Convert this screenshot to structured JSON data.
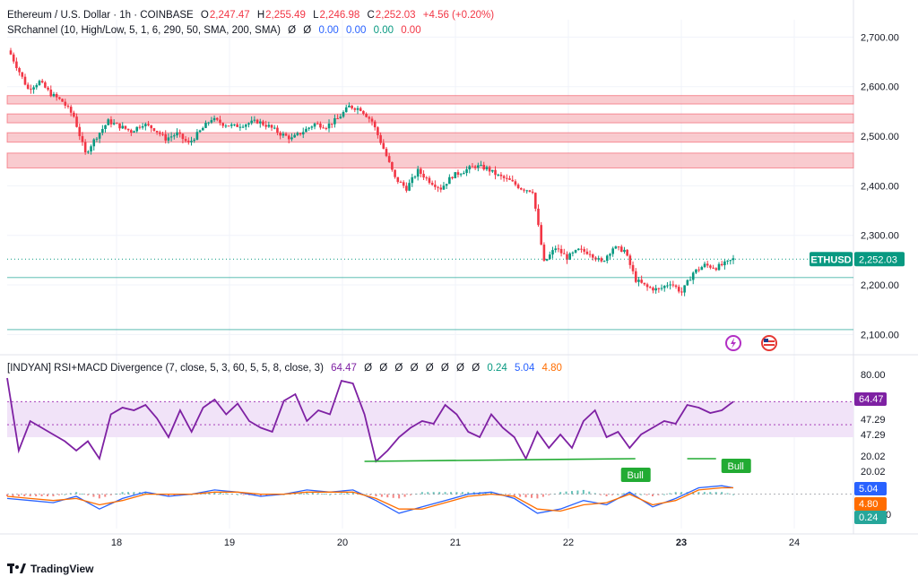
{
  "header": {
    "symbol": "Ethereum / U.S. Dollar · 1h · COINBASE",
    "o_label": "O",
    "o_value": "2,247.47",
    "h_label": "H",
    "h_value": "2,255.49",
    "l_label": "L",
    "l_value": "2,246.98",
    "c_label": "C",
    "c_value": "2,252.03",
    "change": "+4.56 (+0.20%)",
    "indicator1": "SRchannel (10, High/Low, 5, 1, 6, 290, 50, SMA, 200, SMA)",
    "indicator1_values": [
      "Ø",
      "Ø",
      "0.00",
      "0.00",
      "0.00",
      "0.00"
    ],
    "indicator2": "[INDYAN] RSI+MACD Divergence (7, close, 5, 3, 60, 5, 5, 8, close, 3)",
    "indicator2_values": [
      "64.47",
      "Ø",
      "Ø",
      "Ø",
      "Ø",
      "Ø",
      "Ø",
      "Ø",
      "Ø",
      "0.24",
      "5.04",
      "4.80"
    ]
  },
  "footer": {
    "brand": "TradingView"
  },
  "chart_data": [
    {
      "type": "candlestick",
      "ticker_label": "ETHUSD",
      "last_price": "2,252.03",
      "y_ticks": [
        "2,700.00",
        "2,600.00",
        "2,500.00",
        "2,400.00",
        "2,300.00",
        "2,200.00",
        "2,100.00"
      ],
      "ylim": [
        2070,
        2735
      ],
      "x_ticks": [
        "18",
        "19",
        "20",
        "21",
        "22",
        "23",
        "24"
      ],
      "resistance_zones": [
        [
          2565,
          2582
        ],
        [
          2527,
          2545
        ],
        [
          2488,
          2507
        ],
        [
          2436,
          2466
        ]
      ],
      "support_lines": [
        2215,
        2110
      ],
      "close_path": [
        [
          0,
          2665
        ],
        [
          6,
          2595
        ],
        [
          10,
          2610
        ],
        [
          14,
          2585
        ],
        [
          18,
          2570
        ],
        [
          22,
          2540
        ],
        [
          26,
          2465
        ],
        [
          30,
          2500
        ],
        [
          34,
          2530
        ],
        [
          38,
          2520
        ],
        [
          42,
          2510
        ],
        [
          46,
          2525
        ],
        [
          50,
          2515
        ],
        [
          54,
          2495
        ],
        [
          58,
          2505
        ],
        [
          62,
          2485
        ],
        [
          66,
          2510
        ],
        [
          70,
          2535
        ],
        [
          74,
          2525
        ],
        [
          78,
          2520
        ],
        [
          82,
          2525
        ],
        [
          86,
          2530
        ],
        [
          90,
          2520
        ],
        [
          94,
          2505
        ],
        [
          98,
          2495
        ],
        [
          102,
          2510
        ],
        [
          106,
          2525
        ],
        [
          110,
          2520
        ],
        [
          114,
          2535
        ],
        [
          118,
          2560
        ],
        [
          122,
          2555
        ],
        [
          126,
          2530
        ],
        [
          130,
          2475
        ],
        [
          134,
          2415
        ],
        [
          138,
          2395
        ],
        [
          142,
          2430
        ],
        [
          146,
          2410
        ],
        [
          150,
          2395
        ],
        [
          154,
          2420
        ],
        [
          158,
          2430
        ],
        [
          162,
          2440
        ],
        [
          166,
          2435
        ],
        [
          170,
          2420
        ],
        [
          174,
          2410
        ],
        [
          178,
          2395
        ],
        [
          182,
          2390
        ],
        [
          186,
          2245
        ],
        [
          190,
          2275
        ],
        [
          194,
          2255
        ],
        [
          198,
          2270
        ],
        [
          202,
          2265
        ],
        [
          206,
          2245
        ],
        [
          210,
          2275
        ],
        [
          214,
          2270
        ],
        [
          218,
          2210
        ],
        [
          222,
          2195
        ],
        [
          226,
          2190
        ],
        [
          230,
          2205
        ],
        [
          234,
          2185
        ],
        [
          238,
          2225
        ],
        [
          242,
          2240
        ],
        [
          246,
          2235
        ],
        [
          250,
          2245
        ],
        [
          252,
          2252
        ]
      ],
      "current_price": 2252.03
    },
    {
      "type": "line",
      "name": "RSI",
      "y_ticks": [
        "80.00",
        "47.29",
        "47.29",
        "20.02",
        "20.02"
      ],
      "value_labels": [
        "64.47",
        "5.04",
        "4.80",
        "0.24"
      ],
      "ylim": [
        10,
        90
      ],
      "overbought_band": [
        47.29,
        64.47
      ],
      "x": [
        0,
        4,
        8,
        12,
        16,
        20,
        24,
        28,
        32,
        36,
        40,
        44,
        48,
        52,
        56,
        60,
        64,
        68,
        72,
        76,
        80,
        84,
        88,
        92,
        96,
        100,
        104,
        108,
        112,
        116,
        120,
        124,
        128,
        132,
        136,
        140,
        144,
        148,
        152,
        156,
        160,
        164,
        168,
        172,
        176,
        180,
        184,
        188,
        192,
        196,
        200,
        204,
        208,
        212,
        216,
        220,
        224,
        228,
        232,
        236,
        240,
        244,
        248,
        252
      ],
      "values": [
        82,
        28,
        50,
        45,
        40,
        35,
        28,
        35,
        22,
        55,
        60,
        58,
        62,
        52,
        38,
        58,
        42,
        60,
        66,
        55,
        63,
        50,
        45,
        42,
        65,
        70,
        50,
        58,
        55,
        80,
        78,
        55,
        20,
        28,
        38,
        45,
        50,
        48,
        62,
        55,
        42,
        38,
        55,
        45,
        38,
        22,
        42,
        30,
        40,
        30,
        50,
        58,
        38,
        42,
        30,
        40,
        45,
        50,
        48,
        62,
        60,
        56,
        58,
        64.47
      ],
      "divergence_labels": [
        "Bull",
        "Bull"
      ]
    },
    {
      "type": "line",
      "name": "MACD",
      "ylim": [
        -12,
        10
      ],
      "x": [
        0,
        8,
        16,
        24,
        32,
        40,
        48,
        56,
        64,
        72,
        80,
        88,
        96,
        104,
        112,
        120,
        128,
        136,
        144,
        152,
        160,
        168,
        176,
        184,
        192,
        200,
        208,
        216,
        224,
        232,
        240,
        248,
        252
      ],
      "macd": [
        -2,
        -3,
        -4,
        -1,
        -7,
        -2,
        1,
        -1,
        0,
        2,
        1,
        -1,
        0,
        2,
        1,
        2,
        -3,
        -9,
        -6,
        -3,
        0,
        1,
        -2,
        -9,
        -7,
        -3,
        -5,
        1,
        -6,
        -2,
        3,
        4,
        3
      ],
      "signal": [
        -1,
        -2,
        -3,
        -2,
        -5,
        -3,
        0,
        0,
        0,
        1,
        1,
        0,
        0,
        1,
        1,
        1,
        -2,
        -7,
        -7,
        -4,
        -1,
        0,
        -1,
        -7,
        -8,
        -5,
        -4,
        0,
        -5,
        -3,
        2,
        3,
        3
      ]
    }
  ],
  "colors": {
    "up": "#089981",
    "down": "#f23645",
    "zone": "#f7b9bf",
    "zone_edge": "#f23645",
    "support": "#26a69a",
    "rsi": "#7e21a3",
    "band": "#f1e3f8",
    "macd": "#2962ff",
    "signal": "#ff6d00",
    "price_label": "#089981",
    "rsi_label": "#7e21a3"
  }
}
